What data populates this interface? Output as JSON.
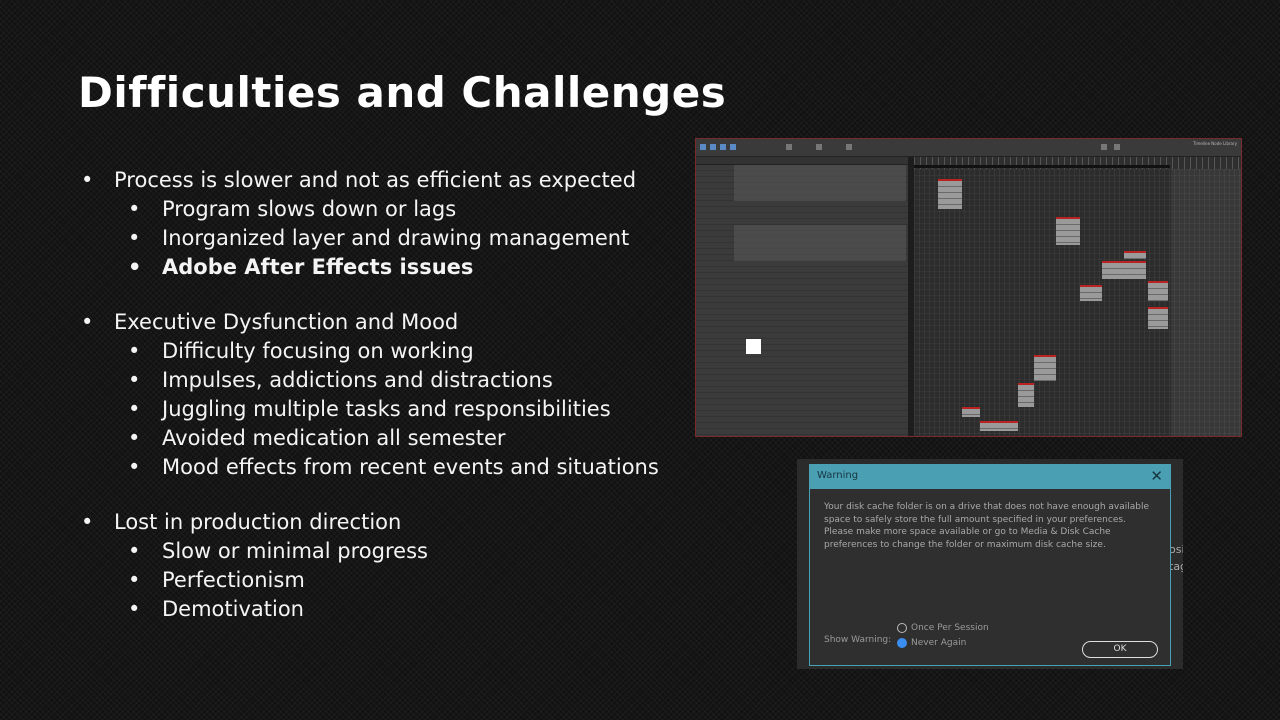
{
  "slide": {
    "title": "Difficulties and Challenges",
    "groups": [
      {
        "heading": "Process is slower and not as efficient as expected",
        "items": [
          {
            "text": "Program slows down or lags",
            "bold": false
          },
          {
            "text": "Inorganized layer and drawing management",
            "bold": false
          },
          {
            "text": "Adobe After Effects issues",
            "bold": true
          }
        ]
      },
      {
        "heading": "Executive Dysfunction and Mood",
        "items": [
          {
            "text": "Difficulty focusing on working",
            "bold": false
          },
          {
            "text": "Impulses, addictions and distractions",
            "bold": false
          },
          {
            "text": "Juggling multiple tasks and responsibilities",
            "bold": false
          },
          {
            "text": "Avoided medication all semester",
            "bold": false
          },
          {
            "text": "Mood effects from recent events and situations",
            "bold": false
          }
        ]
      },
      {
        "heading": "Lost in production direction",
        "items": [
          {
            "text": "Slow or minimal progress",
            "bold": false
          },
          {
            "text": "Perfectionism",
            "bold": false
          },
          {
            "text": "Demotivation",
            "bold": false
          }
        ]
      }
    ]
  },
  "screenshot_timeline": {
    "tabs": "Timeline   Node Library",
    "accent_color": "#b22222"
  },
  "warning_dialog": {
    "title": "Warning",
    "close_glyph": "✕",
    "message": "Your disk cache folder is on a drive that does not have enough available space to safely store the full amount specified in your preferences. Please make more space available or go to Media & Disk Cache preferences to change the folder or maximum disk cache size.",
    "show_warning_label": "Show Warning:",
    "options": [
      "Once Per Session",
      "Never Again"
    ],
    "selected_option": "Never Again",
    "ok_label": "OK",
    "background_text": [
      "osi",
      "tag"
    ],
    "title_bar_color": "#4b9fb3",
    "radio_color": "#3a8ef0"
  }
}
